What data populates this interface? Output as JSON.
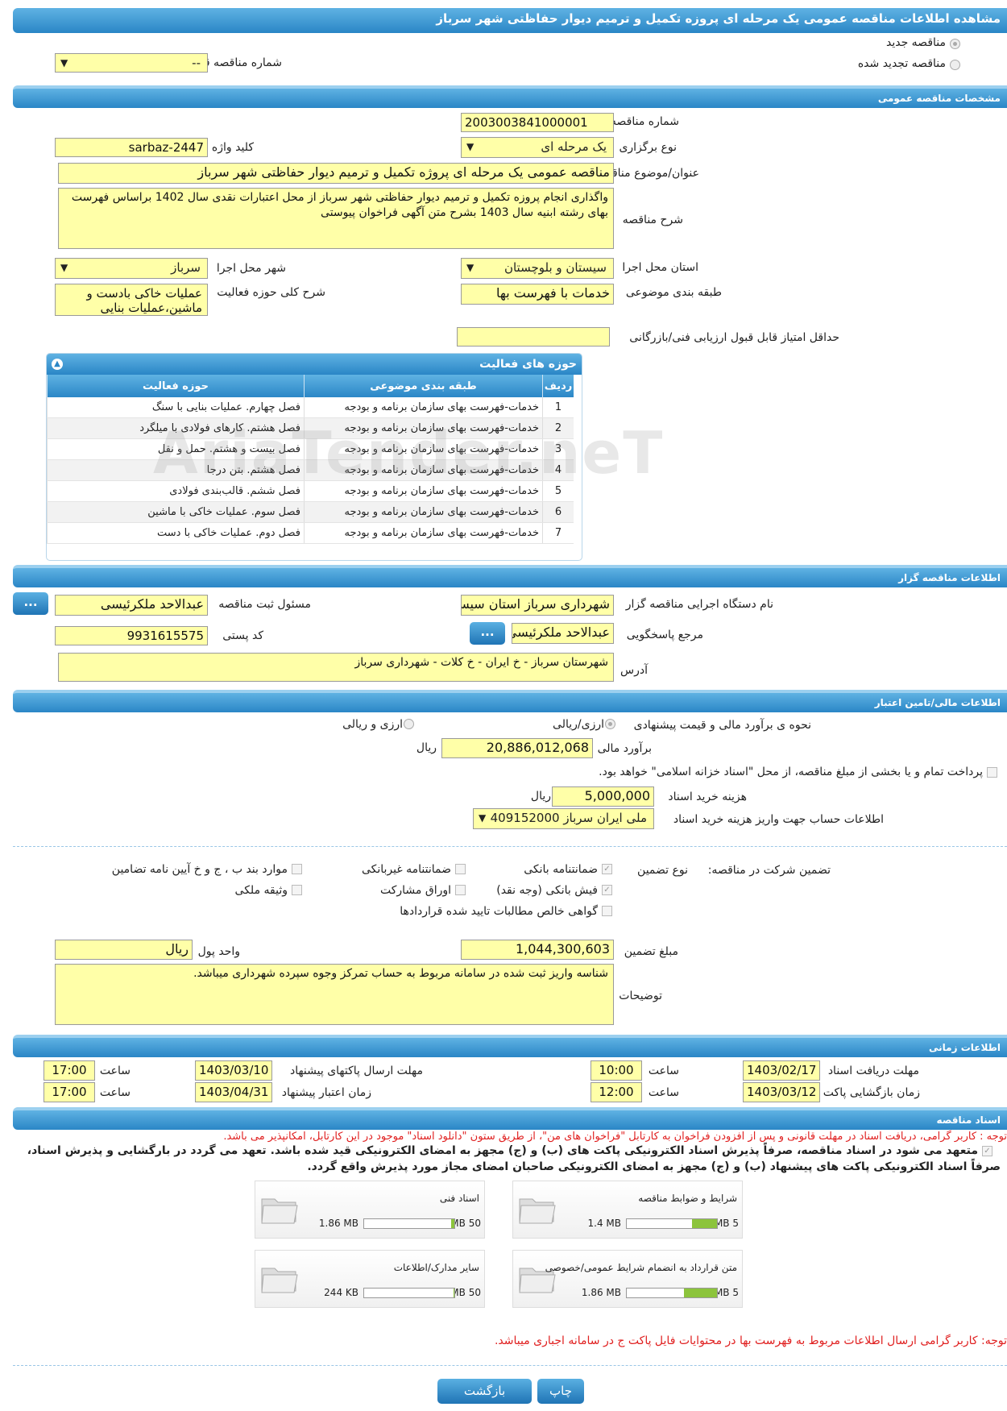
{
  "title": "مشاهده اطلاعات مناقصه عمومی یک مرحله ای پروزه تکمیل و ترمیم دیوار حفاظتی شهر سرباز",
  "top": {
    "new_tender": "مناقصه جدید",
    "renewed_tender": "مناقصه تجدید شده",
    "prev_number_label": "شماره مناقصه قبلی",
    "prev_number_value": "--"
  },
  "general": {
    "section_title": "مشخصات مناقصه عمومی",
    "number_label": "شماره مناقصه",
    "number_value": "2003003841000001",
    "type_label": "نوع برگزاری",
    "type_value": "یک مرحله ای",
    "keyword_label": "کلید واژه",
    "keyword_value": "sarbaz-2447",
    "subject_label": "عنوان/موضوع مناقصه",
    "subject_value": "مناقصه عمومی یک مرحله ای  پروژه تکمیل و ترمیم دیوار حفاظتی شهر سرباز",
    "desc_label": "شرح مناقصه",
    "desc_value": "واگذاری انجام پروزه تکمیل و ترمیم دیوار حفاظتی شهر سرباز  از محل اعتبارات نقدی سال 1402 براساس فهرست بهای رشته ابنیه سال 1403 بشرح متن آگهی فراخوان پیوستی",
    "province_label": "استان محل اجرا",
    "province_value": "سیستان و بلوچستان",
    "city_label": "شهر محل اجرا",
    "city_value": "سرباز",
    "category_label": "طبقه بندی موضوعی",
    "category_value": "خدمات با فهرست بها",
    "scope_label": "شرح کلی حوزه فعالیت",
    "scope_value": "عملیات خاکی بادست و ماشین،عملیات بنایی",
    "min_score_label": "حداقل امتیاز قابل قبول ارزیابی فنی/بازرگانی",
    "min_score_value": ""
  },
  "activities": {
    "title": "حوزه های فعالیت",
    "headers": [
      "ردیف",
      "طبقه بندی موضوعی",
      "حوزه فعالیت"
    ],
    "rows": [
      {
        "n": "1",
        "cat": "خدمات-فهرست بهای سازمان برنامه و بودجه",
        "act": "فصل چهارم. عملیات بنایی با سنگ"
      },
      {
        "n": "2",
        "cat": "خدمات-فهرست بهای سازمان برنامه و بودجه",
        "act": "فصل هشتم. کارهای فولادی با میلگرد"
      },
      {
        "n": "3",
        "cat": "خدمات-فهرست بهای سازمان برنامه و بودجه",
        "act": "فصل بیست و هشتم. حمل و نقل"
      },
      {
        "n": "4",
        "cat": "خدمات-فهرست بهای سازمان برنامه و بودجه",
        "act": "فصل هشتم. بتن درجا"
      },
      {
        "n": "5",
        "cat": "خدمات-فهرست بهای سازمان برنامه و بودجه",
        "act": "فصل ششم. قالب‌بندی فولادی"
      },
      {
        "n": "6",
        "cat": "خدمات-فهرست بهای سازمان برنامه و بودجه",
        "act": "فصل سوم. عملیات خاکی با ماشین"
      },
      {
        "n": "7",
        "cat": "خدمات-فهرست بهای سازمان برنامه و بودجه",
        "act": "فصل دوم. عملیات خاکی با دست"
      }
    ]
  },
  "organizer": {
    "section_title": "اطلاعات مناقصه گزار",
    "agency_label": "نام دستگاه اجرایی مناقصه گزار",
    "agency_value": "شهرداری سرباز استان سیستان",
    "registrar_label": "مسئول ثبت مناقصه",
    "registrar_value": "عبدالاحد ملکرئیسی",
    "responder_label": "مرجع پاسخگویی",
    "responder_value": "عبدالاحد ملکرئیسی",
    "postal_label": "کد پستی",
    "postal_value": "9931615575",
    "address_label": "آدرس",
    "address_value": "شهرستان سرباز - خ ایران - خ کلات - شهرداری سرباز",
    "more_btn": "..."
  },
  "finance": {
    "section_title": "اطلاعات مالی/تامین اعتبار",
    "method_label": "نحوه ی برآورد مالی و قیمت پیشنهادی",
    "opt1": "ارزی/ریالی",
    "opt2": "ارزی و ریالی",
    "estimate_label": "برآورد مالی",
    "estimate_value": "20,886,012,068",
    "currency": "ریال",
    "treasury_text": "پرداخت تمام و یا بخشی از مبلغ مناقصه، از محل \"اسناد خزانه اسلامی\" خواهد بود.",
    "doc_fee_label": "هزینه خرید اسناد",
    "doc_fee_value": "5,000,000",
    "account_label": "اطلاعات حساب جهت واریز هزینه خرید اسناد",
    "account_value": "ملی ایران سرباز 409152000"
  },
  "guarantee": {
    "label": "تضمین شرکت در مناقصه:",
    "type_label": "نوع تضمین",
    "options": [
      "ضمانتنامه بانکی",
      "ضمانتنامه غیربانکی",
      "موارد بند ب ، ج و خ آیین نامه تضامین",
      "فیش بانکی (وجه نقد)",
      "اوراق مشارکت",
      "وثیقه ملکی",
      "گواهی خالص مطالبات تایید شده قراردادها"
    ],
    "amount_label": "مبلغ تضمین",
    "amount_value": "1,044,300,603",
    "unit_label": "واحد پول",
    "unit_value": "ریال",
    "notes_label": "توضیحات",
    "notes_value": "شناسه واریز ثبت شده در سامانه مربوط به حساب تمرکز وجوه سپرده شهرداری میباشد."
  },
  "timing": {
    "section_title": "اطلاعات زمانی",
    "doc_deadline_label": "مهلت دریافت اسناد",
    "doc_deadline_value": "1403/02/17",
    "doc_deadline_time": "10:00",
    "submit_deadline_label": "مهلت ارسال پاکتهای پیشنهاد",
    "submit_deadline_value": "1403/03/10",
    "submit_deadline_time": "17:00",
    "opening_label": "زمان بازگشایی پاکت ها",
    "opening_value": "1403/03/12",
    "opening_time": "12:00",
    "validity_label": "زمان اعتبار پیشنهاد",
    "validity_value": "1403/04/31",
    "validity_time": "17:00",
    "time_label": "ساعت"
  },
  "documents": {
    "section_title": "اسناد مناقصه",
    "note1": "توجه : کاربر گرامی، دریافت اسناد در مهلت قانونی و پس از افزودن فراخوان به کارتابل \"فراخوان های من\"، از طریق ستون \"دانلود اسناد\" موجود در این کارتابل، امکانپذیر می باشد.",
    "commit_line1": "متعهد می شود در اسناد مناقصه، صرفاً پذیرش اسناد الکترونیکی پاکت های (ب) و (ج) مجهز به امضای الکترونیکی قید شده باشد. تعهد می گردد در بارگشایی و پذیرش اسناد،",
    "commit_line2": "صرفاً اسناد الکترونیکی پاکت های پیشنهاد (ب) و (ج) مجهز به امضای الکترونیکی صاحبان امضای مجاز مورد پذیرش واقع گردد.",
    "files": [
      {
        "name": "شرایط و ضوابط مناقصه",
        "size": "1.4 MB",
        "max": "5 MB",
        "fraction": 0.28
      },
      {
        "name": "اسناد فنی",
        "size": "1.86 MB",
        "max": "50 MB",
        "fraction": 0.037
      },
      {
        "name": "متن قرارداد به انضمام شرایط عمومی/خصوصی",
        "size": "1.86 MB",
        "max": "5 MB",
        "fraction": 0.372
      },
      {
        "name": "سایر مدارک/اطلاعات",
        "size": "244 KB",
        "max": "50 MB",
        "fraction": 0.005
      }
    ],
    "note2": "توجه: کاربر گرامی ارسال اطلاعات مربوط به فهرست بها در محتوایات فایل پاکت ج در سامانه اجباری میباشد."
  },
  "buttons": {
    "back": "بازگشت",
    "print": "چاپ"
  },
  "colors": {
    "accent": "#2a86c6",
    "field": "#ffffa8",
    "progress": "#8cc43c",
    "warning": "#e02020"
  },
  "watermark": "AriaTender.neT"
}
